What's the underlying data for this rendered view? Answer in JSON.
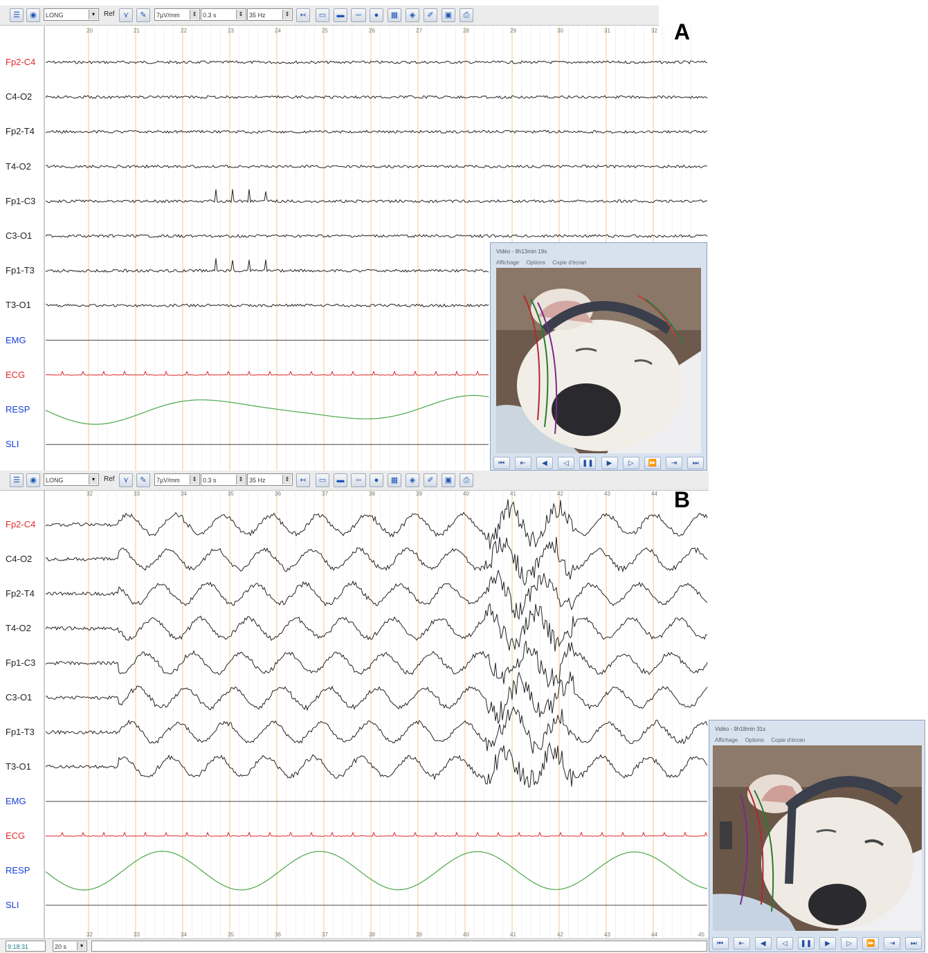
{
  "toolbar": {
    "montage": "LONG",
    "ref_label": "Ref",
    "sensitivity": "7µV/mm",
    "time_constant": "0.3 s",
    "filter": "35 Hz"
  },
  "panels": [
    {
      "letter": "A",
      "seconds": [
        "20",
        "21",
        "22",
        "23",
        "24",
        "25",
        "26",
        "27",
        "28",
        "29",
        "30",
        "31",
        "32"
      ],
      "channels": [
        {
          "name": "Fp2-C4",
          "color": "#e0282b"
        },
        {
          "name": "C4-O2",
          "color": "#222222"
        },
        {
          "name": "Fp2-T4",
          "color": "#222222"
        },
        {
          "name": "T4-O2",
          "color": "#222222"
        },
        {
          "name": "Fp1-C3",
          "color": "#222222"
        },
        {
          "name": "C3-O1",
          "color": "#222222"
        },
        {
          "name": "Fp1-T3",
          "color": "#222222"
        },
        {
          "name": "T3-O1",
          "color": "#222222"
        },
        {
          "name": "EMG",
          "color": "#1a3fd6"
        },
        {
          "name": "ECG",
          "color": "#e0282b"
        },
        {
          "name": "RESP",
          "color": "#1a3fd6"
        },
        {
          "name": "SLI",
          "color": "#1a3fd6"
        }
      ],
      "video": {
        "title": "Vidéo - 9h13min 19s",
        "menu": [
          "Affichage",
          "Options",
          "Copie d'écran"
        ]
      }
    },
    {
      "letter": "B",
      "seconds": [
        "32",
        "33",
        "34",
        "35",
        "36",
        "37",
        "38",
        "39",
        "40",
        "41",
        "42",
        "43",
        "44"
      ],
      "bottom_seconds": [
        "32",
        "33",
        "34",
        "35",
        "36",
        "37",
        "38",
        "39",
        "40",
        "41",
        "42",
        "43",
        "44",
        "45"
      ],
      "channels": [
        {
          "name": "Fp2-C4",
          "color": "#e0282b"
        },
        {
          "name": "C4-O2",
          "color": "#222222"
        },
        {
          "name": "Fp2-T4",
          "color": "#222222"
        },
        {
          "name": "T4-O2",
          "color": "#222222"
        },
        {
          "name": "Fp1-C3",
          "color": "#222222"
        },
        {
          "name": "C3-O1",
          "color": "#222222"
        },
        {
          "name": "Fp1-T3",
          "color": "#222222"
        },
        {
          "name": "T3-O1",
          "color": "#222222"
        },
        {
          "name": "EMG",
          "color": "#1a3fd6"
        },
        {
          "name": "ECG",
          "color": "#e0282b"
        },
        {
          "name": "RESP",
          "color": "#1a3fd6"
        },
        {
          "name": "SLI",
          "color": "#1a3fd6"
        }
      ],
      "video": {
        "title": "Vidéo - 9h18min 31s",
        "menu": [
          "Affichage",
          "Options",
          "Copie d'écran"
        ]
      }
    }
  ],
  "status": {
    "time": "9:18:31",
    "epoch": "20 s"
  },
  "icons": [
    "menu-icon",
    "montage-icon",
    "invert-icon",
    "electrode-icon",
    "scroll-left-icon",
    "window-icon",
    "split-icon",
    "frames-icon",
    "color-map-icon",
    "spectrum-icon",
    "cube-icon",
    "edit-icon",
    "save-icon",
    "print-icon"
  ],
  "video_controls": [
    "first-icon",
    "prev-page-icon",
    "rewind-icon",
    "step-back-icon",
    "pause-icon",
    "play-icon",
    "step-forward-icon",
    "fast-forward-icon",
    "next-page-icon",
    "last-icon"
  ],
  "colors": {
    "grid_line": "#f0c98a",
    "ecg_trace": "#e0282b",
    "resp_trace": "#4aa84a",
    "eeg_trace": "#222222"
  }
}
